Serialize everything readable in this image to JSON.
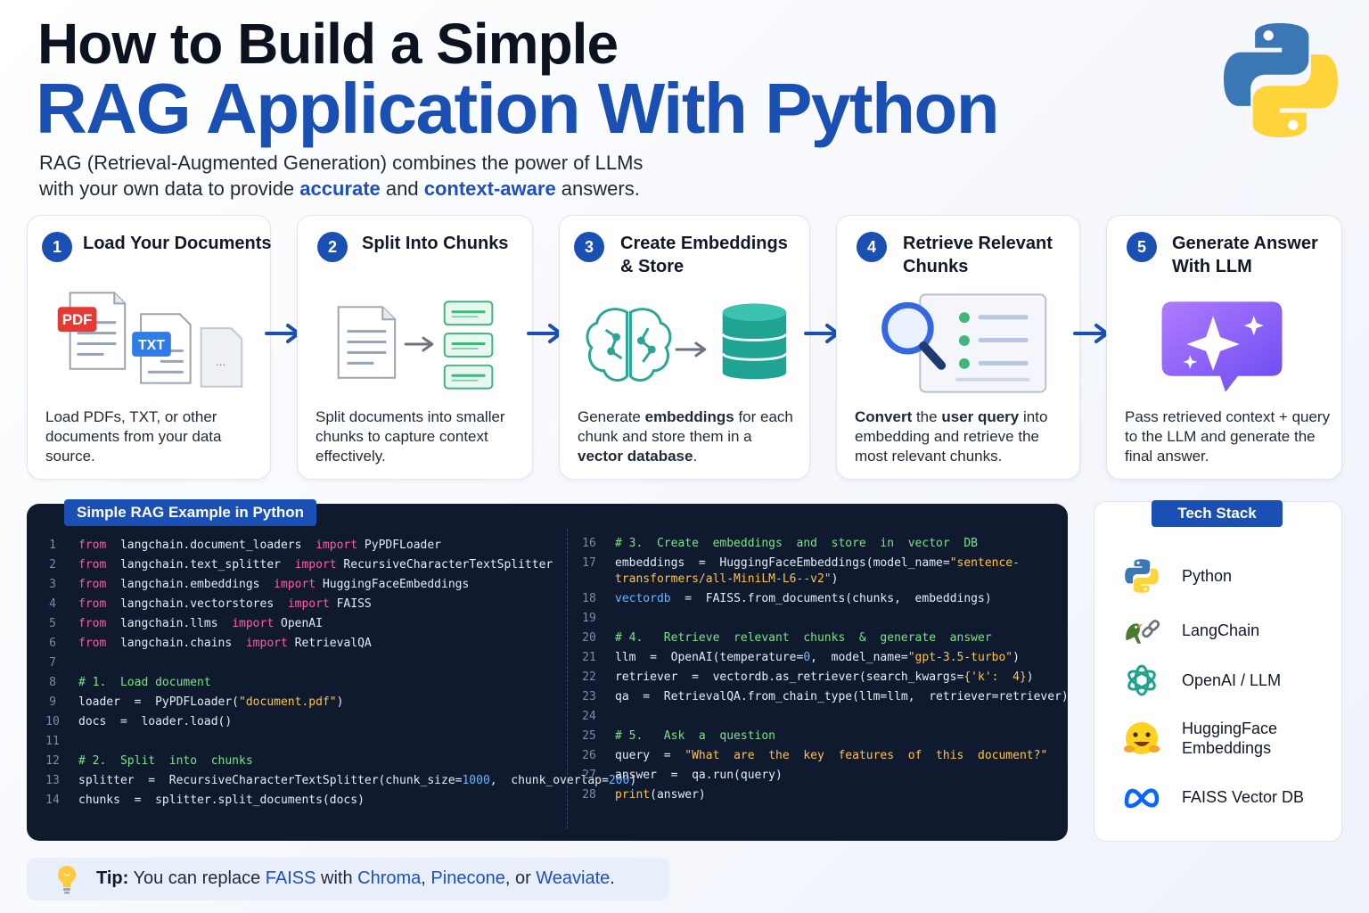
{
  "title_line1": "How to Build a Simple",
  "title_line2": "RAG Application With Python",
  "subtitle": {
    "line1": "RAG (Retrieval-Augmented Generation) combines the power of LLMs",
    "line2_pre": "with your own data to provide ",
    "hl1": "accurate",
    "mid": " and ",
    "hl2": "context-aware",
    "post": " answers."
  },
  "steps": [
    {
      "num": "1",
      "title": "Load Your Documents",
      "badges": [
        "PDF",
        "TXT",
        "..."
      ],
      "desc": "Load PDFs, TXT, or other documents from your data source."
    },
    {
      "num": "2",
      "title": "Split Into Chunks",
      "desc": "Split documents into smaller chunks to capture context effectively."
    },
    {
      "num": "3",
      "title": "Create Embeddings",
      "title2": "& Store",
      "desc_pre": "Generate ",
      "desc_b1": "embeddings",
      "desc_mid": " for each chunk and store them in a ",
      "desc_b2": "vector database",
      "desc_post": "."
    },
    {
      "num": "4",
      "title": "Retrieve Relevant",
      "title2": "Chunks",
      "desc_b1": "Convert",
      "desc_mid": " the ",
      "desc_b2": "user query",
      "desc_post": " into embedding and retrieve the most relevant chunks."
    },
    {
      "num": "5",
      "title": "Generate Answer",
      "title2": "With LLM",
      "desc": "Pass retrieved context + query to the LLM and generate the final answer."
    }
  ],
  "code_title": "Simple RAG Example in Python",
  "stack_title": "Tech Stack",
  "stack": [
    {
      "label": "Python",
      "icon": "python-icon"
    },
    {
      "label": "LangChain",
      "icon": "langchain-icon"
    },
    {
      "label": "OpenAI / LLM",
      "icon": "openai-icon"
    },
    {
      "label": "HuggingFace Embeddings",
      "icon": "huggingface-icon"
    },
    {
      "label": "FAISS Vector DB",
      "icon": "meta-icon"
    }
  ],
  "tip": {
    "label": "Tip:",
    "pre": " You can replace ",
    "faiss": "FAISS",
    "with": " with ",
    "chroma": "Chroma",
    "comma1": ", ",
    "pinecone": "Pinecone",
    "or": ", or ",
    "weaviate": "Weaviate",
    "end": "."
  },
  "code_left": [
    {
      "n": "1",
      "parts": [
        [
          "kw",
          "from"
        ],
        [
          "",
          "  langchain.document_loaders  "
        ],
        [
          "kw",
          "import"
        ],
        [
          "",
          " PyPDFLoader"
        ]
      ]
    },
    {
      "n": "2",
      "parts": [
        [
          "kw",
          "from"
        ],
        [
          "",
          "  langchain.text_splitter  "
        ],
        [
          "kw",
          "import"
        ],
        [
          "",
          " RecursiveCharacterTextSplitter"
        ]
      ]
    },
    {
      "n": "3",
      "parts": [
        [
          "kw",
          "from"
        ],
        [
          "",
          "  langchain.embeddings  "
        ],
        [
          "kw",
          "import"
        ],
        [
          "",
          " HuggingFaceEmbeddings"
        ]
      ]
    },
    {
      "n": "4",
      "parts": [
        [
          "kw",
          "from"
        ],
        [
          "",
          "  langchain.vectorstores  "
        ],
        [
          "kw",
          "import"
        ],
        [
          "",
          " FAISS"
        ]
      ]
    },
    {
      "n": "5",
      "parts": [
        [
          "kw",
          "from"
        ],
        [
          "",
          "  langchain.llms  "
        ],
        [
          "kw",
          "import"
        ],
        [
          "",
          " OpenAI"
        ]
      ]
    },
    {
      "n": "6",
      "parts": [
        [
          "kw",
          "from"
        ],
        [
          "",
          "  langchain.chains  "
        ],
        [
          "kw",
          "import"
        ],
        [
          "",
          " RetrievalQA"
        ]
      ]
    },
    {
      "n": "7",
      "parts": []
    },
    {
      "n": "8",
      "parts": [
        [
          "cm",
          "# 1.  Load document"
        ]
      ]
    },
    {
      "n": "9",
      "parts": [
        [
          "",
          "loader  =  PyPDFLoader("
        ],
        [
          "st",
          "\"document.pdf\""
        ],
        [
          "",
          ")"
        ]
      ]
    },
    {
      "n": "10",
      "parts": [
        [
          "",
          "docs  =  loader.load()"
        ]
      ]
    },
    {
      "n": "11",
      "parts": []
    },
    {
      "n": "12",
      "parts": [
        [
          "cm",
          "# 2.  Split  into  chunks"
        ]
      ]
    },
    {
      "n": "13",
      "parts": [
        [
          "",
          "splitter  =  RecursiveCharacterTextSplitter(chunk_size="
        ],
        [
          "nm",
          "1000"
        ],
        [
          "",
          ",  chunk_overlap="
        ],
        [
          "nm",
          "200"
        ],
        [
          "",
          ")"
        ]
      ]
    },
    {
      "n": "14",
      "parts": [
        [
          "",
          "chunks  =  splitter.split_documents(docs)"
        ]
      ]
    }
  ],
  "code_right": [
    {
      "n": "16",
      "parts": [
        [
          "cm",
          "# 3.  Create  embeddings  and  store  in  vector  DB"
        ]
      ]
    },
    {
      "n": "17",
      "tall": true,
      "parts": [
        [
          "",
          "embeddings  =  HuggingFaceEmbeddings(model_name="
        ],
        [
          "st",
          "\"sentence-transformers/all-MiniLM-L6--v2\""
        ],
        [
          "",
          ")"
        ]
      ]
    },
    {
      "n": "18",
      "parts": [
        [
          "nm",
          "vectordb"
        ],
        [
          "",
          "  =  FAISS.from_documents(chunks,  embeddings)"
        ]
      ]
    },
    {
      "n": "19",
      "parts": []
    },
    {
      "n": "20",
      "parts": [
        [
          "cm",
          "# 4.   Retrieve  relevant  chunks  &  generate  answer"
        ]
      ]
    },
    {
      "n": "21",
      "parts": [
        [
          "",
          "llm  =  OpenAI(temperature="
        ],
        [
          "nm",
          "0"
        ],
        [
          "",
          ",  model_name="
        ],
        [
          "st",
          "\"gpt-3.5-turbo\""
        ],
        [
          "",
          ")"
        ]
      ]
    },
    {
      "n": "22",
      "parts": [
        [
          "",
          "retriever  =  vectordb.as_retriever(search_kwargs="
        ],
        [
          "st",
          "{'k':  4}"
        ],
        [
          "",
          ")"
        ]
      ]
    },
    {
      "n": "23",
      "parts": [
        [
          "",
          "qa  =  RetrievalQA.from_chain_type(llm=llm,  retriever=retriever)"
        ]
      ]
    },
    {
      "n": "24",
      "parts": []
    },
    {
      "n": "25",
      "parts": [
        [
          "cm",
          "# 5.   Ask  a  question"
        ]
      ]
    },
    {
      "n": "26",
      "parts": [
        [
          "",
          "query  =  "
        ],
        [
          "st",
          "\"What  are  the  key  features  of  this  document?\""
        ]
      ]
    },
    {
      "n": "27",
      "parts": [
        [
          "",
          "answer  =  qa.run(query)"
        ]
      ]
    },
    {
      "n": "28",
      "parts": [
        [
          "bi",
          "print"
        ],
        [
          "",
          "(answer)"
        ]
      ]
    }
  ]
}
